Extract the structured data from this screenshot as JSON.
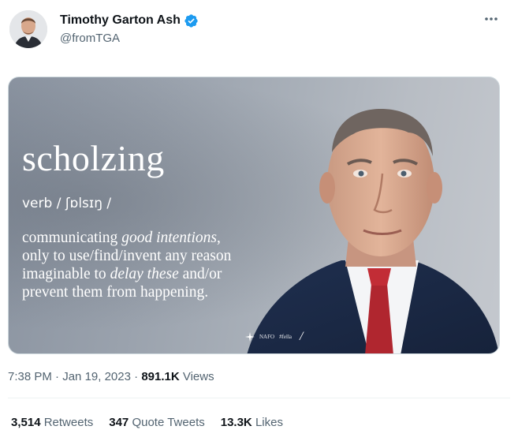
{
  "author": {
    "display_name": "Timothy Garton Ash",
    "handle": "@fromTGA",
    "verified": true
  },
  "media": {
    "word": "scholzing",
    "pronunciation": "verb / ʃɒlsɪŋ /",
    "definition_lines": [
      {
        "pre": "communicating ",
        "em": "good intentions",
        "post": ","
      },
      {
        "pre": "only to use/find/invent any reason",
        "em": "",
        "post": ""
      },
      {
        "pre": "imaginable to ",
        "em": "delay these",
        "post": " and/or"
      },
      {
        "pre": "prevent them from happening.",
        "em": "",
        "post": ""
      }
    ],
    "brand_text": "NAFO",
    "brand_tag": "#fella"
  },
  "meta": {
    "time": "7:38 PM",
    "separator": "·",
    "date": "Jan 19, 2023",
    "views_count": "891.1K",
    "views_label": "Views"
  },
  "stats": {
    "retweets_count": "3,514",
    "retweets_label": "Retweets",
    "quotes_count": "347",
    "quotes_label": "Quote Tweets",
    "likes_count": "13.3K",
    "likes_label": "Likes"
  },
  "colors": {
    "verified": "#1d9bf0",
    "secondary_text": "#536471",
    "primary_text": "#0f1419",
    "divider": "#eff3f4"
  },
  "icons": [
    "verified-badge-icon",
    "more-options-icon",
    "nafo-emblem-icon"
  ]
}
